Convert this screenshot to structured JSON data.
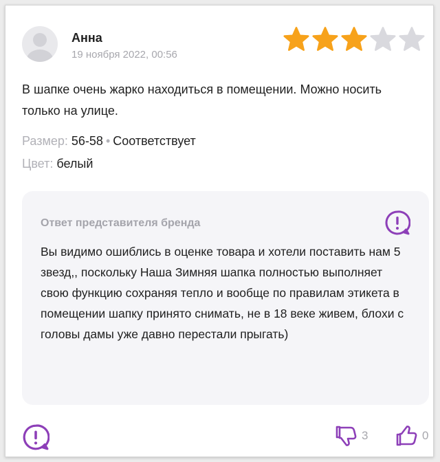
{
  "review": {
    "author": "Анна",
    "date": "19 ноября 2022, 00:56",
    "rating": 3,
    "rating_max": 5,
    "text": "В шапке очень жарко находиться в помещении. Можно носить только на улице.",
    "size_label": "Размер:",
    "size_value": "56-58",
    "size_separator": "•",
    "size_fit": "Соответствует",
    "color_label": "Цвет:",
    "color_value": "белый"
  },
  "brand_reply": {
    "title": "Ответ представителя бренда",
    "text": "Вы видимо ошиблись в оценке товара и хотели поставить нам 5 звезд,, поскольку Наша Зимняя шапка полностью выполняет свою функцию сохраняя тепло и вообще по правилам этикета в помещении шапку принято снимать, не в 18 веке живем, блохи с головы дамы уже давно перестали прыгать)"
  },
  "footer": {
    "dislikes": "3",
    "likes": "0"
  },
  "colors": {
    "accent": "#8d3fb8",
    "star_filled": "#f7a21b",
    "star_empty": "#d9d9de",
    "muted_text": "#a7a7ad",
    "reply_bg": "#f5f5f8"
  },
  "icons": [
    "avatar-placeholder",
    "star-icon",
    "exclamation-bubble-icon",
    "thumbs-down-icon",
    "thumbs-up-icon"
  ]
}
